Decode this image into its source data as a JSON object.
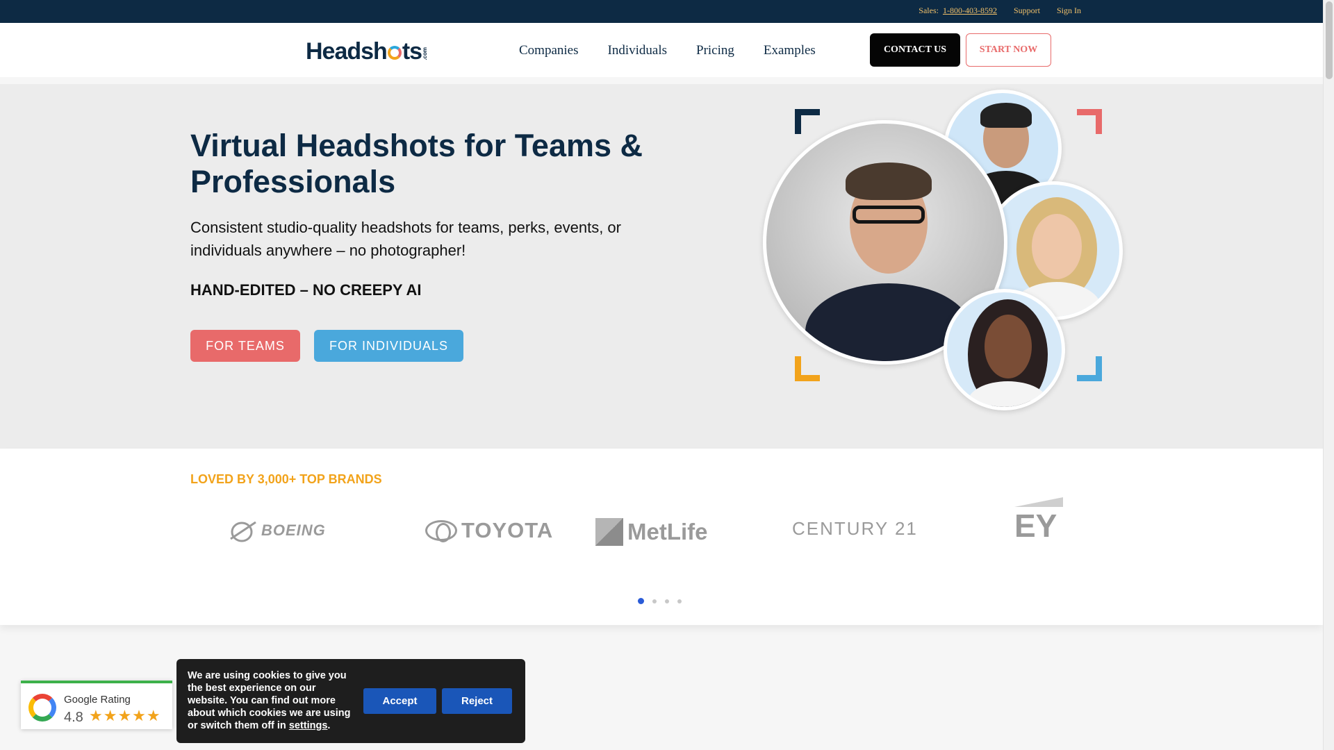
{
  "topbar": {
    "sales_label": "Sales:",
    "phone": "1-800-403-8592",
    "support": "Support",
    "sign_in": "Sign In"
  },
  "header": {
    "logo_text_left": "Headsh",
    "logo_text_right": "ts",
    "logo_suffix": ".com",
    "nav": [
      "Companies",
      "Individuals",
      "Pricing",
      "Examples"
    ],
    "contact_label": "CONTACT US",
    "start_label": "START NOW"
  },
  "hero": {
    "title": "Virtual Headshots for Teams & Professionals",
    "subtitle": "Consistent studio-quality headshots for teams, perks, events, or individuals anywhere – no photographer!",
    "tagline": "HAND-EDITED – NO CREEPY AI",
    "teams_button": "FOR TEAMS",
    "individuals_button": "FOR INDIVIDUALS"
  },
  "brands": {
    "heading": "LOVED BY 3,000+ TOP BRANDS",
    "logos": [
      "BOEING",
      "TOYOTA",
      "MetLife",
      "CENTURY 21",
      "EY"
    ],
    "carousel_pages": 4,
    "active_page": 1
  },
  "google_rating": {
    "label": "Google Rating",
    "score": "4.8",
    "stars": "★★★★★"
  },
  "cookie_banner": {
    "message": "We are using cookies to give you the best experience on our website. You can find out more about which cookies we are using or switch them off in",
    "settings_link": "settings",
    "period": ".",
    "accept": "Accept",
    "reject": "Reject"
  },
  "colors": {
    "navy": "#0d2a44",
    "gold": "#f2a31b",
    "coral": "#e86a6a",
    "blue": "#4aa8dc"
  }
}
